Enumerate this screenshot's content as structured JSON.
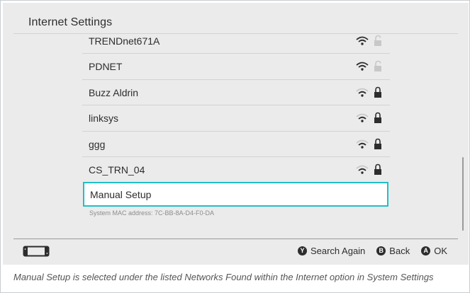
{
  "header": {
    "title": "Internet Settings"
  },
  "networks": [
    {
      "ssid": "TRENDnet671A",
      "wifi_icon": "wifi-signal-icon",
      "lock_icon": "lock-open-icon",
      "secured": false
    },
    {
      "ssid": "PDNET",
      "wifi_icon": "wifi-signal-icon",
      "lock_icon": "lock-open-icon",
      "secured": false
    },
    {
      "ssid": "Buzz Aldrin",
      "wifi_icon": "wifi-signal-icon",
      "lock_icon": "lock-icon",
      "secured": true
    },
    {
      "ssid": "linksys",
      "wifi_icon": "wifi-signal-icon",
      "lock_icon": "lock-icon",
      "secured": true
    },
    {
      "ssid": "ggg",
      "wifi_icon": "wifi-signal-icon",
      "lock_icon": "lock-icon",
      "secured": true
    },
    {
      "ssid": "CS_TRN_04",
      "wifi_icon": "wifi-signal-icon",
      "lock_icon": "lock-icon",
      "secured": true
    }
  ],
  "manual_setup": {
    "label": "Manual Setup",
    "selected": true
  },
  "mac_address": "System MAC address: 7C-BB-8A-D4-F0-DA",
  "footer": {
    "console_icon": "console-icon",
    "actions": [
      {
        "button": "Y",
        "label": "Search Again"
      },
      {
        "button": "B",
        "label": "Back"
      },
      {
        "button": "A",
        "label": "OK"
      }
    ]
  },
  "caption": "Manual Setup is selected under the listed Networks Found within the Internet option in System Settings",
  "colors": {
    "selection": "#1fc0c8",
    "background": "#ebebeb",
    "text": "#2d2d2d"
  }
}
